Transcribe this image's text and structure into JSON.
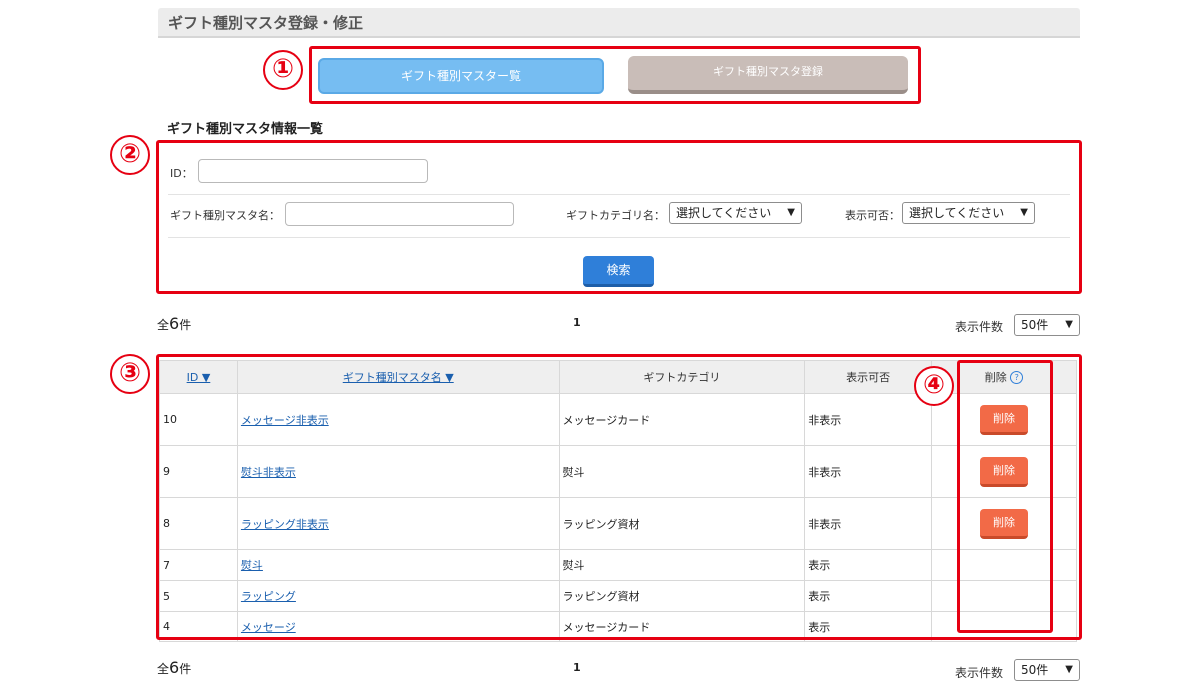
{
  "page_title": "ギフト種別マスタ登録・修正",
  "tabs": [
    {
      "label": "ギフト種別マスター覧"
    },
    {
      "label": "ギフト種別マスタ登録"
    }
  ],
  "annotations": [
    "①",
    "②",
    "③",
    "④"
  ],
  "section_title": "ギフト種別マスタ情報一覧",
  "search": {
    "id_label": "ID：",
    "id_value": "",
    "name_label": "ギフト種別マスタ名：",
    "name_value": "",
    "category_label": "ギフトカテゴリ名：",
    "category_selected": "選択してください",
    "display_label": "表示可否：",
    "display_selected": "選択してください",
    "button_label": "検索"
  },
  "paging": {
    "total_prefix": "全",
    "total_count": "6",
    "total_suffix": "件",
    "page": "1",
    "per_page_label": "表示件数",
    "per_page_selected": "50件"
  },
  "table": {
    "headers": [
      "ID ▼",
      "ギフト種別マスタ名 ▼",
      "ギフトカテゴリ",
      "表示可否",
      "削除"
    ],
    "delete_label": "削除",
    "rows": [
      {
        "id": "10",
        "name": "メッセージ非表示",
        "category": "メッセージカード",
        "display": "非表示",
        "deletable": true
      },
      {
        "id": "9",
        "name": "熨斗非表示",
        "category": "熨斗",
        "display": "非表示",
        "deletable": true
      },
      {
        "id": "8",
        "name": "ラッピング非表示",
        "category": "ラッピング資材",
        "display": "非表示",
        "deletable": true
      },
      {
        "id": "7",
        "name": "熨斗",
        "category": "熨斗",
        "display": "表示",
        "deletable": false
      },
      {
        "id": "5",
        "name": "ラッピング",
        "category": "ラッピング資材",
        "display": "表示",
        "deletable": false
      },
      {
        "id": "4",
        "name": "メッセージ",
        "category": "メッセージカード",
        "display": "表示",
        "deletable": false
      }
    ]
  },
  "colors": {
    "annotation_red": "#e60012",
    "active_tab": "#76bdf2",
    "inactive_tab": "#c9bdb8",
    "search_button": "#2f7fd9",
    "delete_button": "#f26a47",
    "link": "#1a5fae"
  }
}
